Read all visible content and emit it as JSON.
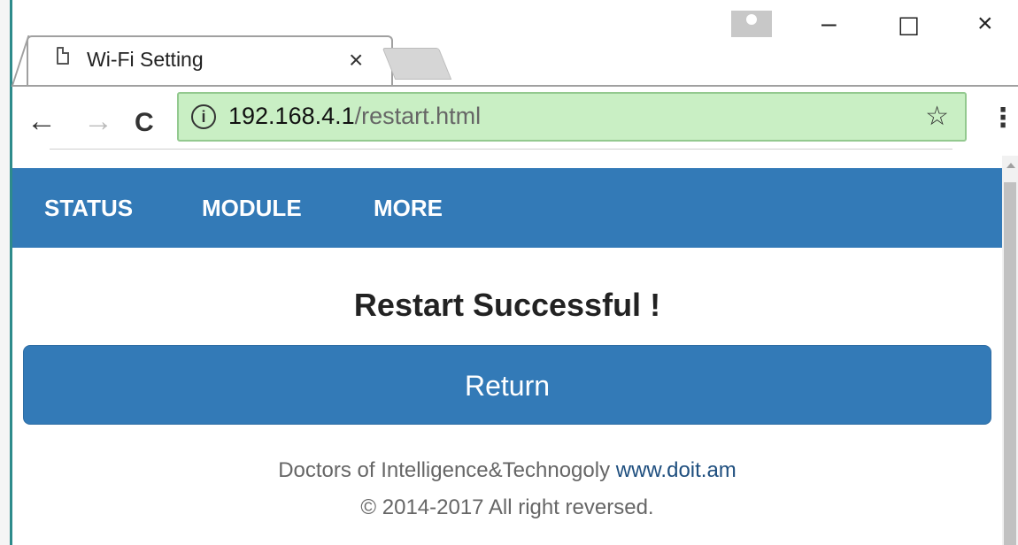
{
  "window": {
    "tab_title": "Wi-Fi Setting",
    "tab_close": "×",
    "minimize": "–",
    "maximize": "☐",
    "close": "×"
  },
  "toolbar": {
    "back": "←",
    "forward": "→",
    "reload": "C",
    "info_icon": "i",
    "url_host": "192.168.4.1",
    "url_path": "/restart.html",
    "bookmark": "☆",
    "menu": "⋮"
  },
  "nav": {
    "items": [
      "STATUS",
      "MODULE",
      "MORE"
    ]
  },
  "main": {
    "heading": "Restart Successful !",
    "return_button": "Return"
  },
  "footer": {
    "company": "Doctors of Intelligence&Technogoly",
    "link": "www.doit.am",
    "copyright": "© 2014-2017 All right reversed."
  },
  "colors": {
    "navbar": "#337ab7",
    "button": "#337ab7",
    "omnibox": "#c9efc4"
  },
  "icons": [
    "page-icon",
    "info-icon",
    "star-icon",
    "menu-icon",
    "profile-icon"
  ]
}
